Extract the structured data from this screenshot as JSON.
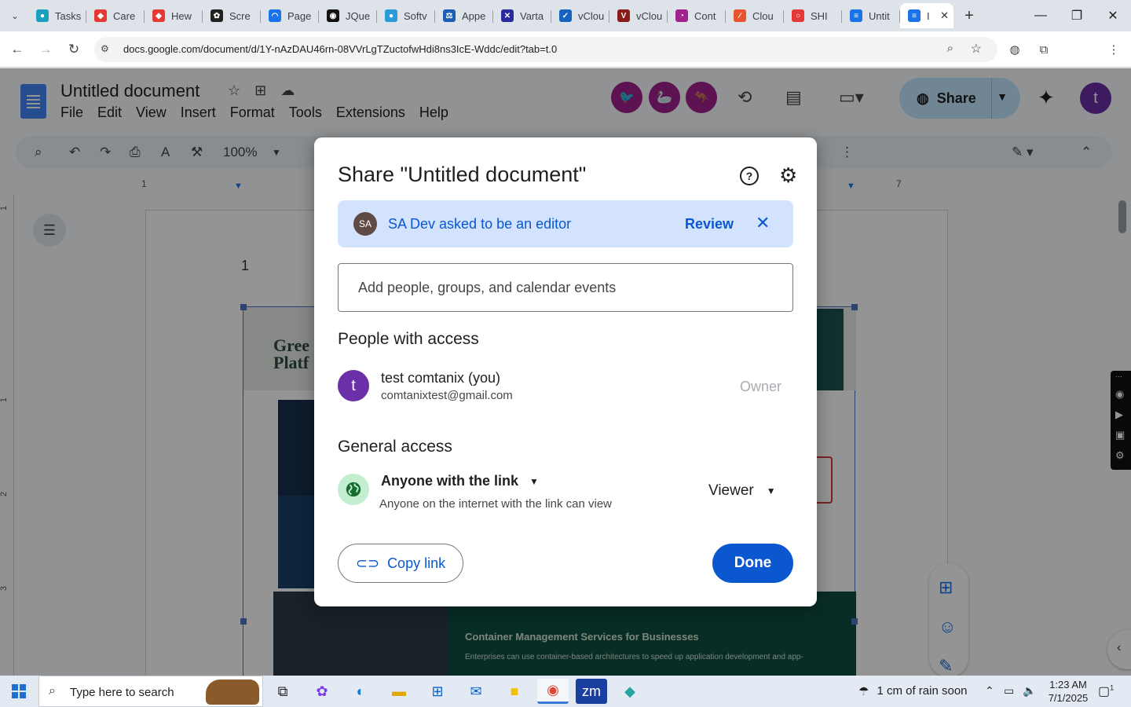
{
  "browser": {
    "tabs": [
      {
        "label": "Tasks",
        "color": "#1a9fbf",
        "glyph": "●"
      },
      {
        "label": "Care",
        "color": "#e53935",
        "glyph": "◆"
      },
      {
        "label": "Hew",
        "color": "#e53935",
        "glyph": "◆"
      },
      {
        "label": "Scre",
        "color": "#222222",
        "glyph": "✿"
      },
      {
        "label": "Page",
        "color": "#1a73e8",
        "glyph": "◠"
      },
      {
        "label": "JQue",
        "color": "#111111",
        "glyph": "◉"
      },
      {
        "label": "Softv",
        "color": "#2a9bd6",
        "glyph": "●"
      },
      {
        "label": "Appe",
        "color": "#1a5fb4",
        "glyph": "⚖"
      },
      {
        "label": "Varta",
        "color": "#2a2aa0",
        "glyph": "✕"
      },
      {
        "label": "vClou",
        "color": "#1565c0",
        "glyph": "✓"
      },
      {
        "label": "vClou",
        "color": "#8b1a1a",
        "glyph": "V"
      },
      {
        "label": "Cont",
        "color": "#a0228d",
        "glyph": "◔"
      },
      {
        "label": "Clou",
        "color": "#e8552d",
        "glyph": "∕"
      },
      {
        "label": "SHI",
        "color": "#e53935",
        "glyph": "○"
      },
      {
        "label": "Untit",
        "color": "#1a73e8",
        "glyph": "≡"
      },
      {
        "label": "I",
        "color": "#1a73e8",
        "glyph": "≡",
        "active": true
      }
    ],
    "url": "docs.google.com/document/d/1Y-nAzDAU46rn-08VVrLgTZuctofwHdi8ns3IcE-Wddc/edit?tab=t.0",
    "profile_initial": "t"
  },
  "docs": {
    "title": "Untitled document",
    "menus": [
      "File",
      "Edit",
      "View",
      "Insert",
      "Format",
      "Tools",
      "Extensions",
      "Help"
    ],
    "share_label": "Share",
    "avatar_initial": "t",
    "zoom": "100%",
    "page_number": "1",
    "ruler_numbers": [
      "1",
      "7"
    ],
    "vruler_numbers": [
      "1",
      "1",
      "2",
      "3"
    ],
    "image_heading": "Gree\nPlatf",
    "image_bottom_title": "Container Management Services for Businesses",
    "image_bottom_text": "Enterprises can use container-based architectures to speed up application development and app-"
  },
  "dialog": {
    "title": "Share \"Untitled document\"",
    "request": {
      "avatar": "SA",
      "text": "SA Dev asked to be an editor",
      "review_label": "Review"
    },
    "add_placeholder": "Add people, groups, and calendar events",
    "people_title": "People with access",
    "person": {
      "initial": "t",
      "name": "test comtanix (you)",
      "email": "comtanixtest@gmail.com",
      "role": "Owner"
    },
    "general_title": "General access",
    "general": {
      "scope": "Anyone with the link",
      "description": "Anyone on the internet with the link can view",
      "role": "Viewer"
    },
    "copy_label": "Copy link",
    "done_label": "Done"
  },
  "taskbar": {
    "search_placeholder": "Type here to search",
    "weather": "1 cm of rain soon",
    "time": "1:23 AM",
    "date": "7/1/2025",
    "notification_count": "1"
  }
}
